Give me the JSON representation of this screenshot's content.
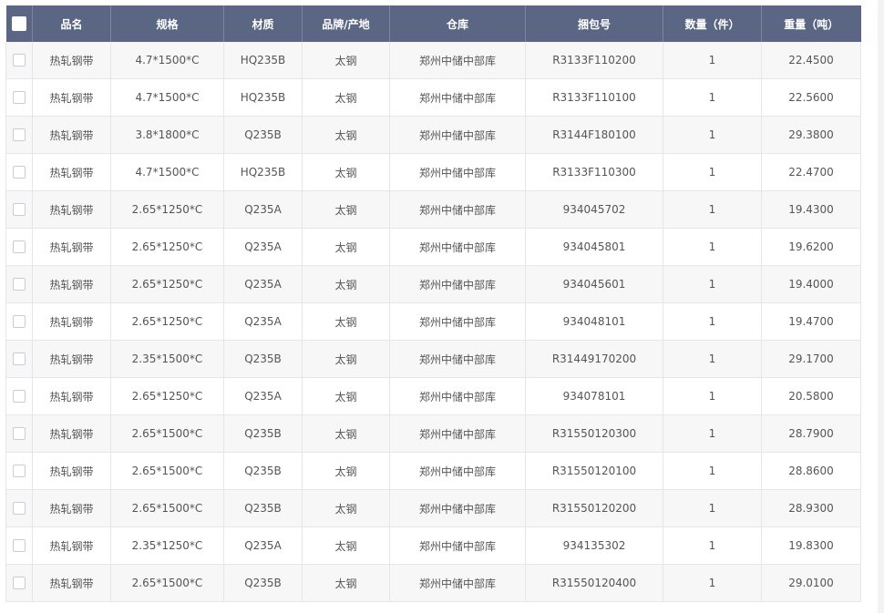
{
  "table": {
    "headers": [
      "品名",
      "规格",
      "材质",
      "品牌/产地",
      "仓库",
      "捆包号",
      "数量（件）",
      "重量（吨）"
    ],
    "rows": [
      [
        "热轧钢带",
        "4.7*1500*C",
        "HQ235B",
        "太钢",
        "郑州中储中部库",
        "R3133F110200",
        "1",
        "22.4500"
      ],
      [
        "热轧钢带",
        "4.7*1500*C",
        "HQ235B",
        "太钢",
        "郑州中储中部库",
        "R3133F110100",
        "1",
        "22.5600"
      ],
      [
        "热轧钢带",
        "3.8*1800*C",
        "Q235B",
        "太钢",
        "郑州中储中部库",
        "R3144F180100",
        "1",
        "29.3800"
      ],
      [
        "热轧钢带",
        "4.7*1500*C",
        "HQ235B",
        "太钢",
        "郑州中储中部库",
        "R3133F110300",
        "1",
        "22.4700"
      ],
      [
        "热轧钢带",
        "2.65*1250*C",
        "Q235A",
        "太钢",
        "郑州中储中部库",
        "934045702",
        "1",
        "19.4300"
      ],
      [
        "热轧钢带",
        "2.65*1250*C",
        "Q235A",
        "太钢",
        "郑州中储中部库",
        "934045801",
        "1",
        "19.6200"
      ],
      [
        "热轧钢带",
        "2.65*1250*C",
        "Q235A",
        "太钢",
        "郑州中储中部库",
        "934045601",
        "1",
        "19.4000"
      ],
      [
        "热轧钢带",
        "2.65*1250*C",
        "Q235A",
        "太钢",
        "郑州中储中部库",
        "934048101",
        "1",
        "19.4700"
      ],
      [
        "热轧钢带",
        "2.35*1500*C",
        "Q235B",
        "太钢",
        "郑州中储中部库",
        "R31449170200",
        "1",
        "29.1700"
      ],
      [
        "热轧钢带",
        "2.65*1250*C",
        "Q235A",
        "太钢",
        "郑州中储中部库",
        "934078101",
        "1",
        "20.5800"
      ],
      [
        "热轧钢带",
        "2.65*1500*C",
        "Q235B",
        "太钢",
        "郑州中储中部库",
        "R31550120300",
        "1",
        "28.7900"
      ],
      [
        "热轧钢带",
        "2.65*1500*C",
        "Q235B",
        "太钢",
        "郑州中储中部库",
        "R31550120100",
        "1",
        "28.8600"
      ],
      [
        "热轧钢带",
        "2.65*1500*C",
        "Q235B",
        "太钢",
        "郑州中储中部库",
        "R31550120200",
        "1",
        "28.9300"
      ],
      [
        "热轧钢带",
        "2.35*1250*C",
        "Q235A",
        "太钢",
        "郑州中储中部库",
        "934135302",
        "1",
        "19.8300"
      ],
      [
        "热轧钢带",
        "2.65*1500*C",
        "Q235B",
        "太钢",
        "郑州中储中部库",
        "R31550120400",
        "1",
        "29.0100"
      ]
    ]
  },
  "colors": {
    "header_bg": "#5a6684",
    "stripe_bg": "#f7f7f8",
    "border": "#e4e6ea"
  }
}
